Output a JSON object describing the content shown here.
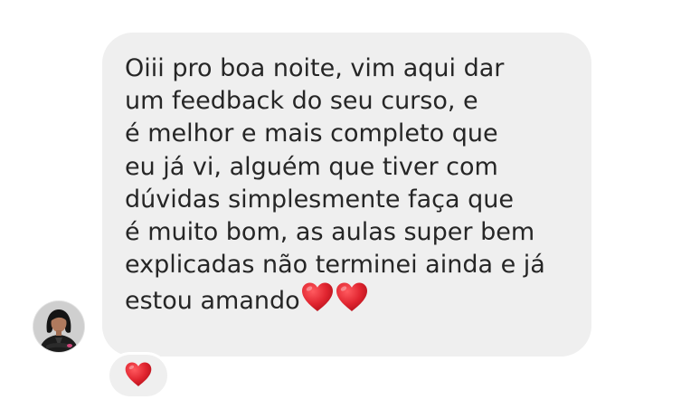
{
  "conversation": {
    "message": {
      "lines": [
        "Oiii pro boa noite, vim aqui dar",
        "um feedback do seu curso, e",
        "é melhor e mais completo que",
        "eu já vi, alguém que tiver com",
        "dúvidas simplesmente faça que",
        "é muito bom, as aulas super bem",
        "explicadas não terminei ainda e já",
        "estou amando"
      ],
      "trailing_emojis": [
        "red-heart-icon",
        "red-heart-icon"
      ]
    },
    "reaction": {
      "emoji": "red-heart-icon",
      "count": 1
    },
    "sender": {
      "avatar": "profile-photo"
    }
  },
  "colors": {
    "bubble_background": "#efefef",
    "text": "#262626",
    "heart": "#e0242f"
  }
}
